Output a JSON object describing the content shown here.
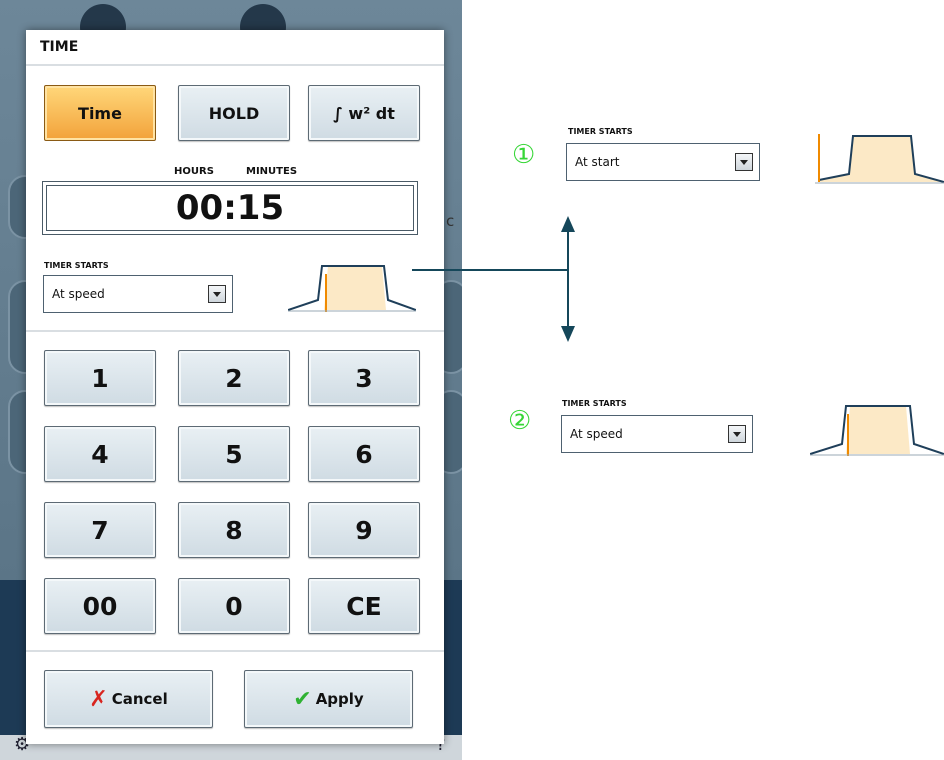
{
  "dialog": {
    "title": "TIME",
    "modes": [
      {
        "label": "Time",
        "active": true
      },
      {
        "label": "HOLD",
        "active": false
      },
      {
        "label": "∫ w² dt",
        "active": false
      }
    ],
    "time_labels": {
      "hours": "HOURS",
      "minutes": "MINUTES"
    },
    "time_value": "00:15",
    "timer_starts_label": "TIMER STARTS",
    "timer_starts_value": "At speed",
    "keypad": [
      "1",
      "2",
      "3",
      "4",
      "5",
      "6",
      "7",
      "8",
      "9",
      "00",
      "0",
      "CE"
    ],
    "cancel_label": "Cancel",
    "apply_label": "Apply"
  },
  "background": {
    "partial_letter": "c"
  },
  "annotations": {
    "option1": {
      "number": "①",
      "label": "TIMER STARTS",
      "value": "At start"
    },
    "option2": {
      "number": "②",
      "label": "TIMER STARTS",
      "value": "At speed"
    }
  },
  "colors": {
    "accent_orange": "#f2a23a",
    "profile_fill": "#fce9c6",
    "profile_line": "#1f3f5a",
    "marker_orange": "#f08a00",
    "annotation_green": "#36d636",
    "connector": "#15475a"
  }
}
